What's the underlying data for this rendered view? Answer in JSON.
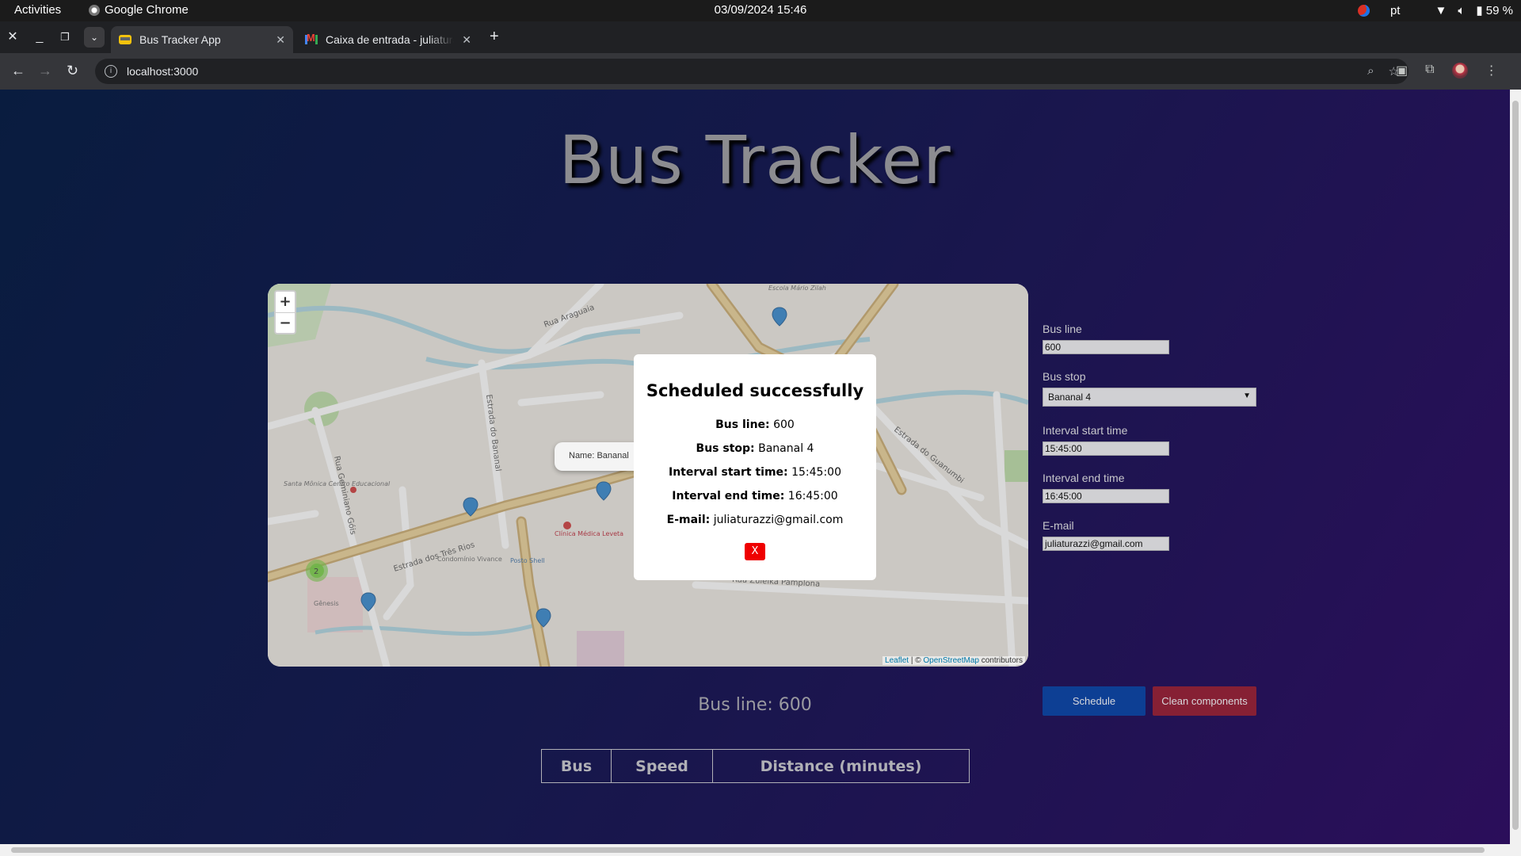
{
  "os": {
    "activities": "Activities",
    "app_name": "Google Chrome",
    "clock": "03/09/2024 15:46",
    "language": "pt",
    "battery": "59 %"
  },
  "browser": {
    "tabs": [
      {
        "title": "Bus Tracker App",
        "active": true
      },
      {
        "title": "Caixa de entrada - juliatura",
        "active": false
      }
    ],
    "url": "localhost:3000"
  },
  "page": {
    "title": "Bus Tracker",
    "map": {
      "zoom_in": "+",
      "zoom_out": "−",
      "tooltip": "Name: Bananal",
      "attribution_leaflet": "Leaflet",
      "attribution_sep": " | © ",
      "attribution_osm": "OpenStreetMap",
      "attribution_tail": " contributors",
      "street_labels": [
        "Rua Araguaia",
        "Estrada dos Três Rios",
        "Estrada do Bananal",
        "Rua Geminiano Góis",
        "Estrada do Guanumbi",
        "Rua Zuleika Pamplona",
        "Santa Mônica Centro Educacional",
        "Clínica Médica Leveta",
        "Condomínio Vivance",
        "Posto Shell",
        "Gênesis",
        "Escola Mário Zilah"
      ],
      "cluster_count": "2"
    },
    "modal": {
      "title": "Scheduled successfully",
      "rows": [
        {
          "label": "Bus line:",
          "value": "600"
        },
        {
          "label": "Bus stop:",
          "value": "Bananal 4"
        },
        {
          "label": "Interval start time:",
          "value": "15:45:00"
        },
        {
          "label": "Interval end time:",
          "value": "16:45:00"
        },
        {
          "label": "E-mail:",
          "value": "juliaturazzi@gmail.com"
        }
      ],
      "close_label": "X"
    },
    "form": {
      "bus_line_label": "Bus line",
      "bus_line_value": "600",
      "bus_stop_label": "Bus stop",
      "bus_stop_value": "Bananal 4",
      "start_label": "Interval start time",
      "start_value": "15:45:00",
      "end_label": "Interval end time",
      "end_value": "16:45:00",
      "email_label": "E-mail",
      "email_value": "juliaturazzi@gmail.com",
      "schedule_button": "Schedule",
      "clean_button": "Clean components"
    },
    "bus_line_heading": "Bus line: 600",
    "table_headers": [
      "Bus",
      "Speed",
      "Distance (minutes)"
    ]
  }
}
